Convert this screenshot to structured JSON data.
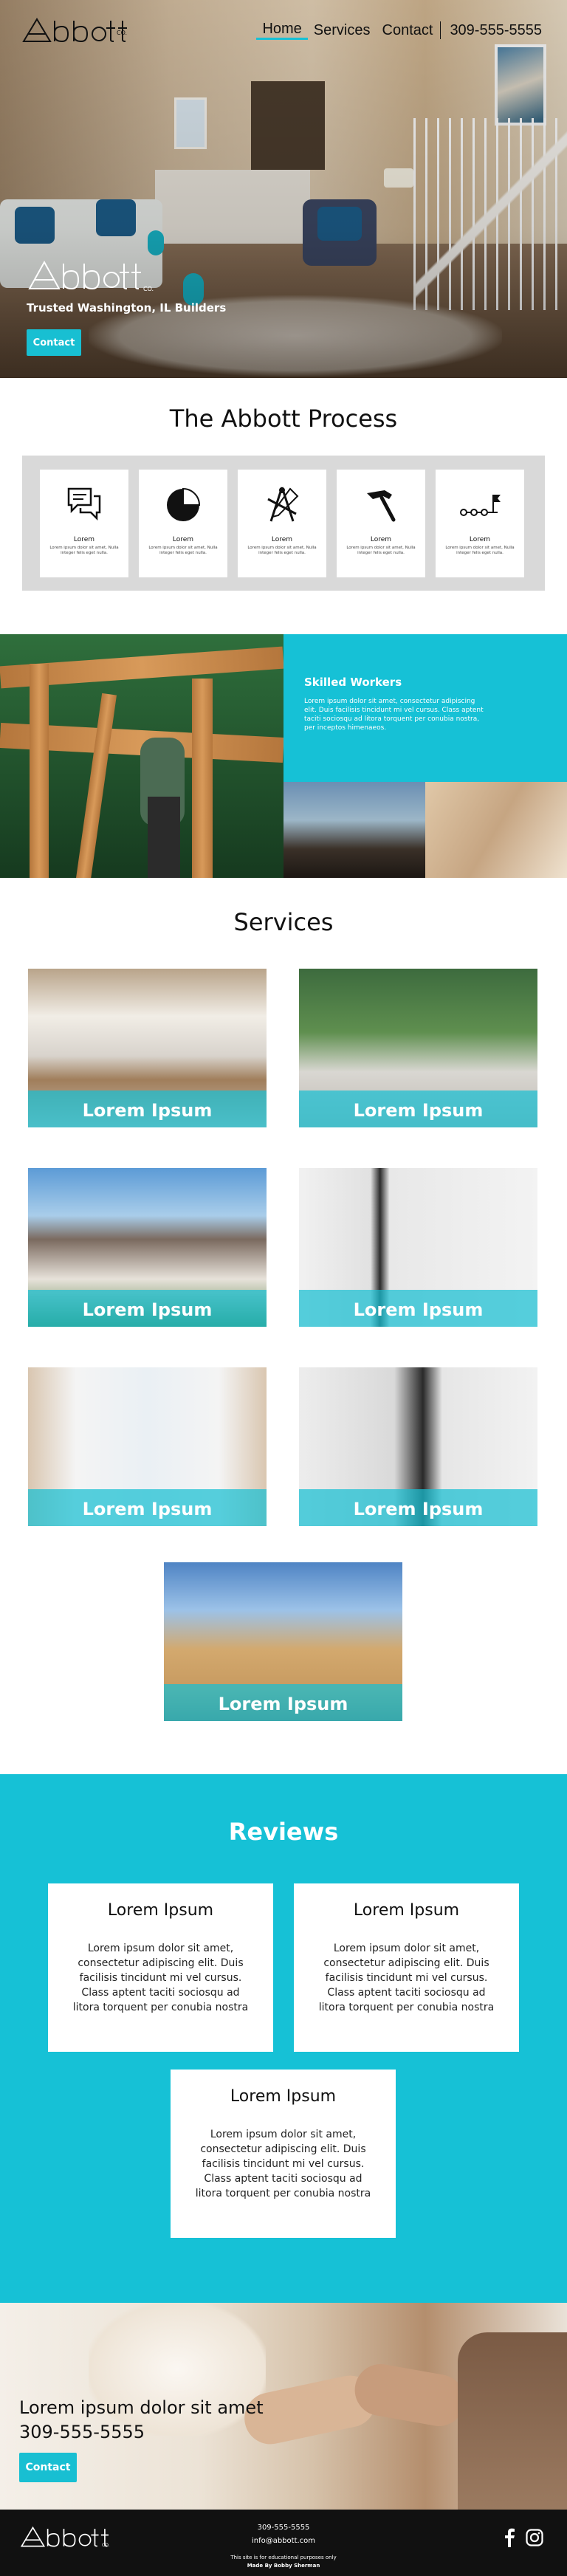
{
  "nav": {
    "brand": "Abbott",
    "brand_suffix": "CO.",
    "items": [
      {
        "label": "Home",
        "active": true
      },
      {
        "label": "Services",
        "active": false
      },
      {
        "label": "Contact",
        "active": false
      }
    ],
    "phone": "309-555-5555"
  },
  "hero": {
    "logo_text": "Abbott",
    "logo_suffix": "CO.",
    "tagline": "Trusted Washington, IL Builders",
    "button": "Contact"
  },
  "process": {
    "title": "The Abbott Process",
    "steps": [
      {
        "icon": "chat-bubbles-icon",
        "title": "Lorem",
        "text": "Lorem ipsum dolor sit amet, Nulla integer felis eget nulla."
      },
      {
        "icon": "pie-chart-icon",
        "title": "Lorem",
        "text": "Lorem ipsum dolor sit amet, Nulla integer felis eget nulla."
      },
      {
        "icon": "design-tools-icon",
        "title": "Lorem",
        "text": "Lorem ipsum dolor sit amet, Nulla integer felis eget nulla."
      },
      {
        "icon": "hammer-icon",
        "title": "Lorem",
        "text": "Lorem ipsum dolor sit amet, Nulla integer felis eget nulla."
      },
      {
        "icon": "timeline-flag-icon",
        "title": "Lorem",
        "text": "Lorem ipsum dolor sit amet, Nulla integer felis eget nulla."
      }
    ]
  },
  "skilled": {
    "title": "Skilled Workers",
    "text": "Lorem ipsum dolor sit amet, consectetur adipiscing elit. Duis facilisis tincidunt mi vel cursus. Class aptent taciti sociosqu ad litora torquent per conubia nostra, per inceptos himenaeos."
  },
  "services": {
    "title": "Services",
    "items": [
      {
        "label": "Lorem Ipsum",
        "image": "kitchen"
      },
      {
        "label": "Lorem Ipsum",
        "image": "patio"
      },
      {
        "label": "Lorem Ipsum",
        "image": "house"
      },
      {
        "label": "Lorem Ipsum",
        "image": "porch"
      },
      {
        "label": "Lorem Ipsum",
        "image": "window"
      },
      {
        "label": "Lorem Ipsum",
        "image": "entry"
      },
      {
        "label": "Lorem Ipsum",
        "image": "construction"
      }
    ]
  },
  "reviews": {
    "title": "Reviews",
    "items": [
      {
        "title": "Lorem Ipsum",
        "text": "Lorem ipsum dolor sit amet, consectetur adipiscing elit. Duis facilisis tincidunt mi vel cursus. Class aptent taciti sociosqu ad litora torquent per conubia nostra"
      },
      {
        "title": "Lorem Ipsum",
        "text": "Lorem ipsum dolor sit amet, consectetur adipiscing elit. Duis facilisis tincidunt mi vel cursus. Class aptent taciti sociosqu ad litora torquent per conubia nostra"
      },
      {
        "title": "Lorem Ipsum",
        "text": "Lorem ipsum dolor sit amet, consectetur adipiscing elit. Duis facilisis tincidunt mi vel cursus. Class aptent taciti sociosqu ad litora torquent per conubia nostra"
      }
    ]
  },
  "cta": {
    "heading": "Lorem ipsum dolor sit amet",
    "phone": "309-555-5555",
    "button": "Contact"
  },
  "footer": {
    "logo_text": "Abbott",
    "logo_suffix": "CO.",
    "phone": "309-555-5555",
    "email": "info@abbott.com",
    "note": "This site is for educational purposes only",
    "credit": "Made By Bobby Sherman",
    "social": [
      "facebook-icon",
      "instagram-icon"
    ]
  },
  "colors": {
    "accent": "#16c1d6",
    "dark": "#111111",
    "panel": "#d9d9d9"
  }
}
